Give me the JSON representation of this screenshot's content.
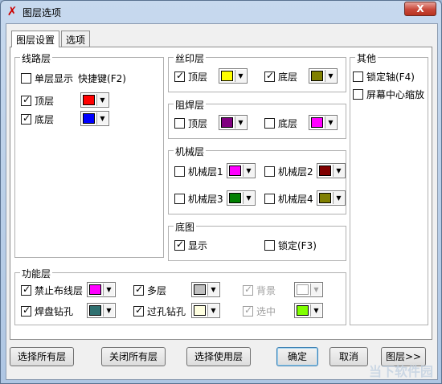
{
  "window": {
    "title": "图层选项",
    "close_label": "X"
  },
  "tabs": [
    {
      "label": "图层设置"
    },
    {
      "label": "选项"
    }
  ],
  "groups": {
    "trace": "线路层",
    "silk": "丝印层",
    "solder": "阻焊层",
    "mech": "机械层",
    "base": "底图",
    "func": "功能层",
    "other": "其他"
  },
  "trace": {
    "single": "单层显示",
    "shortcut": "快捷键(F2)",
    "top": "顶层",
    "bottom": "底层",
    "top_color": "#ff0000",
    "bottom_color": "#0000ff"
  },
  "silk": {
    "top": "顶层",
    "bottom": "底层",
    "top_color": "#ffff00",
    "bottom_color": "#808000"
  },
  "solder": {
    "top": "顶层",
    "bottom": "底层",
    "top_color": "#800080",
    "bottom_color": "#ff00ff"
  },
  "mech": {
    "m1": "机械层1",
    "m2": "机械层2",
    "m3": "机械层3",
    "m4": "机械层4",
    "m1_color": "#ff00ff",
    "m2_color": "#800000",
    "m3_color": "#008000",
    "m4_color": "#808000"
  },
  "base": {
    "show": "显示",
    "lock": "锁定(F3)"
  },
  "func": {
    "no_route": "禁止布线层",
    "multi": "多层",
    "background": "背景",
    "pad_drill": "焊盘钻孔",
    "via_drill": "过孔钻孔",
    "selected": "选中",
    "no_route_color": "#ff00ff",
    "multi_color": "#c0c0c0",
    "background_color": "#ffffff",
    "pad_drill_color": "#2f7070",
    "via_drill_color": "#ffffe0",
    "selected_color": "#80ff00"
  },
  "other": {
    "lock_axis": "锁定轴(F4)",
    "zoom_center": "屏幕中心缩放"
  },
  "buttons": {
    "select_all": "选择所有层",
    "close_all": "关闭所有层",
    "select_used": "选择使用层",
    "ok": "确定",
    "cancel": "取消",
    "layers": "图层>>"
  },
  "watermark": "当下软件园"
}
